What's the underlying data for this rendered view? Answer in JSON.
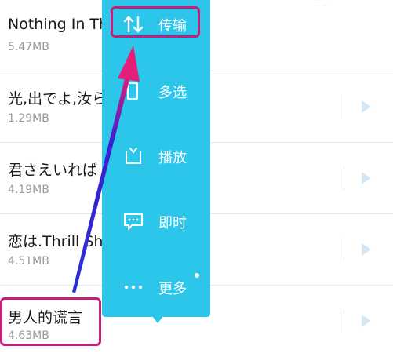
{
  "songs": [
    {
      "title": "Nothing In Th",
      "size": "5.47MB"
    },
    {
      "title": "光,出でよ,汝ら",
      "size": "1.29MB"
    },
    {
      "title": "君さえいれば",
      "size": "4.19MB"
    },
    {
      "title": "恋は.Thrill Sh",
      "size": "4.51MB"
    },
    {
      "title": "男人的谎言",
      "size": "4.63MB"
    }
  ],
  "menu": {
    "items": [
      {
        "label": "传输",
        "icon": "transfer-icon"
      },
      {
        "label": "多选",
        "icon": "multi-select-icon"
      },
      {
        "label": "播放",
        "icon": "play-queue-icon"
      },
      {
        "label": "即时",
        "icon": "chat-icon"
      },
      {
        "label": "更多",
        "icon": "more-icon"
      }
    ]
  },
  "colors": {
    "menu_bg": "#2cc6ea",
    "highlight": "#c41e7c",
    "arrow": "#2a2fd6"
  }
}
